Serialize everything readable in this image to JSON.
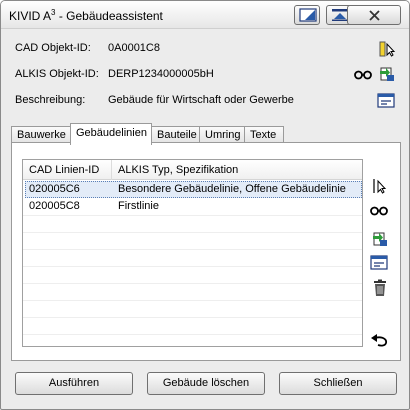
{
  "window": {
    "title_main": "KIVID A",
    "title_sup": "3",
    "title_rest": " - Gebäudeassistent"
  },
  "fields": {
    "cad_label": "CAD Objekt-ID:",
    "cad_value": "0A0001C8",
    "alkis_label": "ALKIS Objekt-ID:",
    "alkis_value": "DERP1234000005bH",
    "desc_label": "Beschreibung:",
    "desc_value": "Gebäude für Wirtschaft oder Gewerbe"
  },
  "tabs": [
    {
      "label": "Bauwerke"
    },
    {
      "label": "Gebäudelinien"
    },
    {
      "label": "Bauteile"
    },
    {
      "label": "Umring"
    },
    {
      "label": "Texte"
    }
  ],
  "list": {
    "col1": "CAD Linien-ID",
    "col2": "ALKIS Typ, Spezifikation",
    "rows": [
      {
        "id": "020005C6",
        "typ": "Besondere Gebäudelinie, Offene Gebäudelinie"
      },
      {
        "id": "020005C8",
        "typ": "Firstlinie"
      }
    ]
  },
  "buttons": {
    "run": "Ausführen",
    "delete": "Gebäude löschen",
    "close": "Schließen"
  },
  "icons": {
    "select": "select-object-icon",
    "view": "glasses-view-icon",
    "assign": "assign-icon",
    "properties": "properties-form-icon",
    "delete": "trash-icon",
    "undo": "undo-icon"
  },
  "colors": {
    "selection": "#e3ecf8",
    "accent_green": "#2e9c3a",
    "accent_yellow": "#f2d22e",
    "accent_blue": "#2a5ba8"
  }
}
